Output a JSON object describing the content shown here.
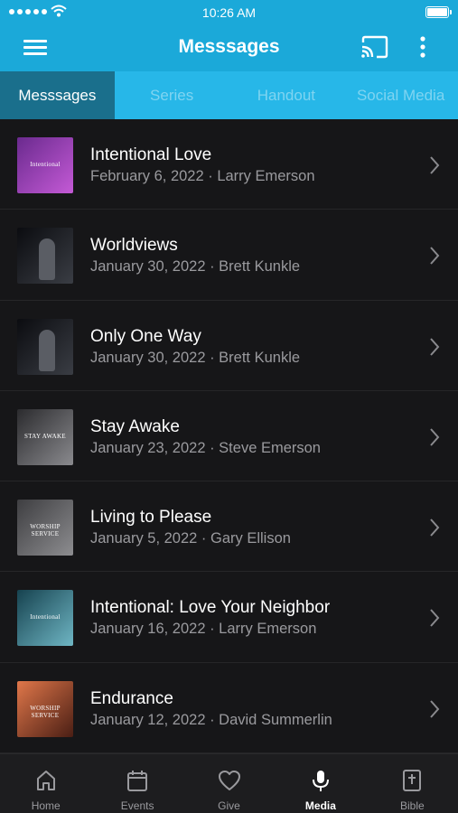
{
  "status_bar": {
    "time": "10:26 AM"
  },
  "app_bar": {
    "title": "Messsages"
  },
  "tabs": [
    {
      "label": "Messsages",
      "active": true
    },
    {
      "label": "Series",
      "active": false
    },
    {
      "label": "Handout",
      "active": false
    },
    {
      "label": "Social Media",
      "active": false
    }
  ],
  "messages": [
    {
      "title": "Intentional Love",
      "subtitle": "February 6, 2022 · Larry Emerson",
      "thumb_text": "Intentional",
      "thumb_colors": [
        "#6a2a8e",
        "#c45ad6"
      ]
    },
    {
      "title": "Worldviews",
      "subtitle": "January 30, 2022 · Brett Kunkle",
      "thumb_text": "",
      "thumb_colors": [
        "#0b0c10",
        "#3a3d44"
      ]
    },
    {
      "title": "Only One Way",
      "subtitle": "January 30, 2022 · Brett Kunkle",
      "thumb_text": "",
      "thumb_colors": [
        "#0b0c10",
        "#3a3d44"
      ]
    },
    {
      "title": "Stay Awake",
      "subtitle": "January 23, 2022 · Steve Emerson",
      "thumb_text": "STAY AWAKE",
      "thumb_colors": [
        "#2b2b2e",
        "#8a8a8e"
      ]
    },
    {
      "title": "Living to Please",
      "subtitle": "January 5, 2022 · Gary Ellison",
      "thumb_text": "WORSHIP SERVICE",
      "thumb_colors": [
        "#3e3e41",
        "#8d8d90"
      ]
    },
    {
      "title": "Intentional: Love Your Neighbor",
      "subtitle": "January 16, 2022 · Larry Emerson",
      "thumb_text": "Intentional",
      "thumb_colors": [
        "#16424f",
        "#6fb6c4"
      ]
    },
    {
      "title": "Endurance",
      "subtitle": "January 12, 2022 · David Summerlin",
      "thumb_text": "WORSHIP SERVICE",
      "thumb_colors": [
        "#e0774a",
        "#4a1e14"
      ]
    }
  ],
  "bottom_nav": [
    {
      "label": "Home",
      "icon": "home-icon",
      "active": false
    },
    {
      "label": "Events",
      "icon": "calendar-icon",
      "active": false
    },
    {
      "label": "Give",
      "icon": "heart-icon",
      "active": false
    },
    {
      "label": "Media",
      "icon": "microphone-icon",
      "active": true
    },
    {
      "label": "Bible",
      "icon": "bible-icon",
      "active": false
    }
  ],
  "colors": {
    "brand": "#1ba9d9",
    "tab_bar": "#27b7e8",
    "tab_active": "#1a6f8c",
    "background": "#161618"
  }
}
